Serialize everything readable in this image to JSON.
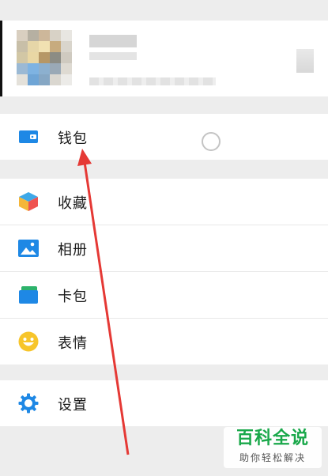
{
  "menu": {
    "wallet": "钱包",
    "favorites": "收藏",
    "album": "相册",
    "cards": "卡包",
    "stickers": "表情",
    "settings": "设置"
  },
  "watermark": {
    "title": "百科全说",
    "subtitle": "助你轻松解决"
  },
  "colors": {
    "accent_blue": "#1e88e5",
    "watermark_green": "#19a84a",
    "annotation_red": "#e53935"
  },
  "icons": {
    "wallet": "wallet-icon",
    "favorites": "cube-icon",
    "album": "image-icon",
    "cards": "card-icon",
    "stickers": "smiley-icon",
    "settings": "gear-icon"
  }
}
